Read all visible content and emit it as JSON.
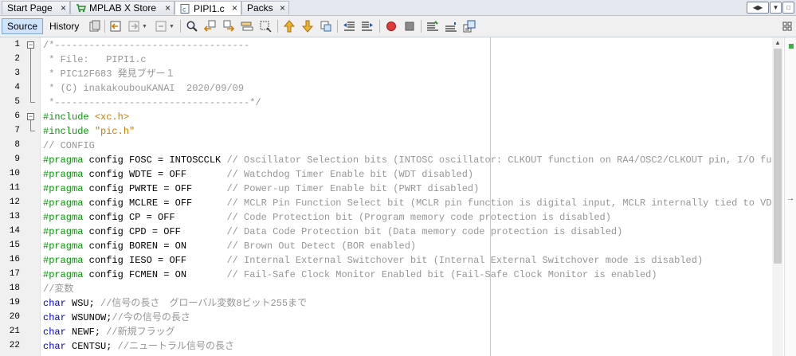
{
  "tabs": [
    {
      "label": "Start Page",
      "icon": "none"
    },
    {
      "label": "MPLAB X Store",
      "icon": "cart-icon"
    },
    {
      "label": "PIPI1.c",
      "icon": "c-file-icon",
      "active": true
    },
    {
      "label": "Packs",
      "icon": "none"
    }
  ],
  "toolbar": {
    "source_label": "Source",
    "history_label": "History"
  },
  "editor": {
    "lines": [
      {
        "n": "1",
        "segs": [
          {
            "t": "/*----------------------------------",
            "c": "com"
          }
        ]
      },
      {
        "n": "2",
        "segs": [
          {
            "t": " * File:   PIPI1.c",
            "c": "com"
          }
        ]
      },
      {
        "n": "3",
        "segs": [
          {
            "t": " * PIC12F683 発見ブザー１",
            "c": "com"
          }
        ]
      },
      {
        "n": "4",
        "segs": [
          {
            "t": " * (C) inakakoubouKANAI  2020/09/09",
            "c": "com"
          }
        ]
      },
      {
        "n": "5",
        "segs": [
          {
            "t": " *----------------------------------*/",
            "c": "com"
          }
        ]
      },
      {
        "n": "6",
        "segs": [
          {
            "t": "#include ",
            "c": "dir"
          },
          {
            "t": "<xc.h>",
            "c": "str"
          }
        ]
      },
      {
        "n": "7",
        "segs": [
          {
            "t": "#include ",
            "c": "dir"
          },
          {
            "t": "\"pic.h\"",
            "c": "str"
          }
        ]
      },
      {
        "n": "8",
        "segs": [
          {
            "t": "// CONFIG",
            "c": "com"
          }
        ]
      },
      {
        "n": "9",
        "segs": [
          {
            "t": "#pragma",
            "c": "dir"
          },
          {
            "t": " config FOSC = INTOSCCLK ",
            "c": "pl"
          },
          {
            "t": "// Oscillator Selection bits (INTOSC oscillator: CLKOUT function on RA4/OSC2/CLKOUT pin, I/O functi",
            "c": "com"
          }
        ]
      },
      {
        "n": "10",
        "segs": [
          {
            "t": "#pragma",
            "c": "dir"
          },
          {
            "t": " config WDTE = OFF       ",
            "c": "pl"
          },
          {
            "t": "// Watchdog Timer Enable bit (WDT disabled)",
            "c": "com"
          }
        ]
      },
      {
        "n": "11",
        "segs": [
          {
            "t": "#pragma",
            "c": "dir"
          },
          {
            "t": " config PWRTE = OFF      ",
            "c": "pl"
          },
          {
            "t": "// Power-up Timer Enable bit (PWRT disabled)",
            "c": "com"
          }
        ]
      },
      {
        "n": "12",
        "segs": [
          {
            "t": "#pragma",
            "c": "dir"
          },
          {
            "t": " config MCLRE = OFF      ",
            "c": "pl"
          },
          {
            "t": "// MCLR Pin Function Select bit (MCLR pin function is digital input, MCLR internally tied to VDD)",
            "c": "com"
          }
        ]
      },
      {
        "n": "13",
        "segs": [
          {
            "t": "#pragma",
            "c": "dir"
          },
          {
            "t": " config CP = OFF         ",
            "c": "pl"
          },
          {
            "t": "// Code Protection bit (Program memory code protection is disabled)",
            "c": "com"
          }
        ]
      },
      {
        "n": "14",
        "segs": [
          {
            "t": "#pragma",
            "c": "dir"
          },
          {
            "t": " config CPD = OFF        ",
            "c": "pl"
          },
          {
            "t": "// Data Code Protection bit (Data memory code protection is disabled)",
            "c": "com"
          }
        ]
      },
      {
        "n": "15",
        "segs": [
          {
            "t": "#pragma",
            "c": "dir"
          },
          {
            "t": " config BOREN = ON       ",
            "c": "pl"
          },
          {
            "t": "// Brown Out Detect (BOR enabled)",
            "c": "com"
          }
        ]
      },
      {
        "n": "16",
        "segs": [
          {
            "t": "#pragma",
            "c": "dir"
          },
          {
            "t": " config IESO = OFF       ",
            "c": "pl"
          },
          {
            "t": "// Internal External Switchover bit (Internal External Switchover mode is disabled)",
            "c": "com"
          }
        ]
      },
      {
        "n": "17",
        "segs": [
          {
            "t": "#pragma",
            "c": "dir"
          },
          {
            "t": " config FCMEN = ON       ",
            "c": "pl"
          },
          {
            "t": "// Fail-Safe Clock Monitor Enabled bit (Fail-Safe Clock Monitor is enabled)",
            "c": "com"
          }
        ]
      },
      {
        "n": "18",
        "segs": [
          {
            "t": "//変数",
            "c": "com"
          }
        ]
      },
      {
        "n": "19",
        "segs": [
          {
            "t": "char",
            "c": "kw"
          },
          {
            "t": " WSU; ",
            "c": "pl"
          },
          {
            "t": "//信号の長さ　グローバル変数8ビット255まで",
            "c": "com"
          }
        ]
      },
      {
        "n": "20",
        "segs": [
          {
            "t": "char",
            "c": "kw"
          },
          {
            "t": " WSUNOW;",
            "c": "pl"
          },
          {
            "t": "//今の信号の長さ",
            "c": "com"
          }
        ]
      },
      {
        "n": "21",
        "segs": [
          {
            "t": "char",
            "c": "kw"
          },
          {
            "t": " NEWF; ",
            "c": "pl"
          },
          {
            "t": "//新規フラッグ",
            "c": "com"
          }
        ]
      },
      {
        "n": "22",
        "segs": [
          {
            "t": "char",
            "c": "kw"
          },
          {
            "t": " CENTSU; ",
            "c": "pl"
          },
          {
            "t": "//ニュートラル信号の長さ",
            "c": "com"
          }
        ]
      }
    ]
  }
}
